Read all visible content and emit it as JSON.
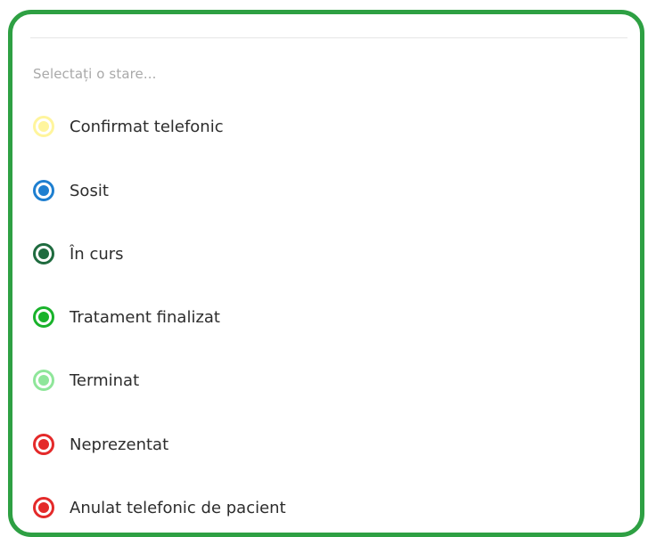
{
  "status_select": {
    "placeholder": "Selectați o stare...",
    "options": [
      {
        "label": "Confirmat telefonic",
        "icon": "radio-dot-icon",
        "color": "#fff59d",
        "ring": "#fff59d"
      },
      {
        "label": "Sosit",
        "icon": "radio-dot-icon",
        "color": "#1e7fd0",
        "ring": "#1e7fd0"
      },
      {
        "label": "În curs",
        "icon": "radio-dot-icon",
        "color": "#1f6b3f",
        "ring": "#1f6b3f"
      },
      {
        "label": "Tratament finalizat",
        "icon": "radio-dot-icon",
        "color": "#19b32b",
        "ring": "#19b32b"
      },
      {
        "label": "Terminat",
        "icon": "radio-dot-icon",
        "color": "#8fe69a",
        "ring": "#8fe69a"
      },
      {
        "label": "Neprezentat",
        "icon": "radio-dot-icon",
        "color": "#e42a2a",
        "ring": "#e42a2a"
      },
      {
        "label": "Anulat telefonic de pacient",
        "icon": "radio-dot-icon",
        "color": "#e42a2a",
        "ring": "#e42a2a"
      }
    ]
  },
  "frame": {
    "border_color": "#2ea043"
  }
}
